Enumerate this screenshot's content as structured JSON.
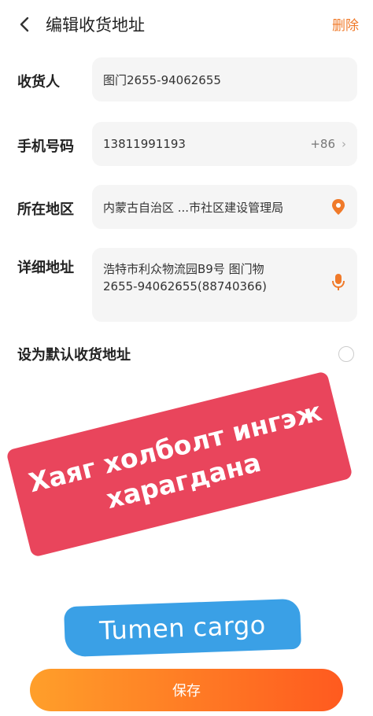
{
  "header": {
    "title": "编辑收货地址",
    "delete_label": "删除"
  },
  "form": {
    "recipient": {
      "label": "收货人",
      "value": "图门2655-94062655"
    },
    "phone": {
      "label": "手机号码",
      "value": "13811991193",
      "country_code": "+86"
    },
    "region": {
      "label": "所在地区",
      "value": "内蒙古自治区 ...市社区建设管理局"
    },
    "address": {
      "label": "详细地址",
      "value": "浩特市利众物流园B9号 图门物\n2655-94062655(88740366)"
    },
    "default": {
      "label": "设为默认收货地址"
    }
  },
  "overlay": {
    "banner_line1": "Хаяг холболт ингэж",
    "banner_line2": "харагдана",
    "brand": "Tumen cargo"
  },
  "actions": {
    "save_label": "保存"
  },
  "colors": {
    "accent": "#f07a2a",
    "banner": "#e9455c",
    "brush": "#3aa0e6"
  }
}
